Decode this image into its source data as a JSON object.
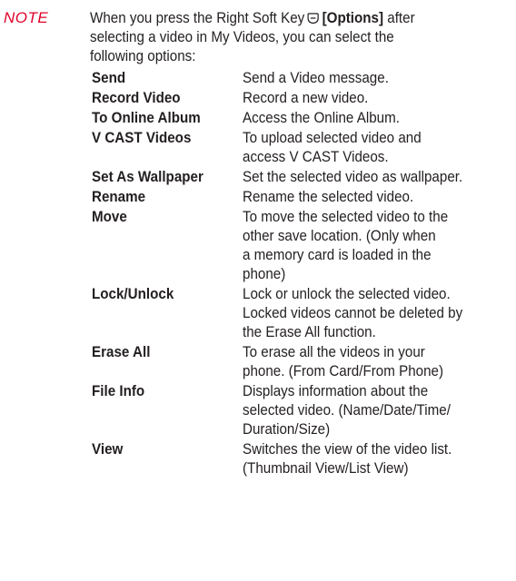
{
  "note": {
    "label": "NOTE",
    "text_before_key": "When you press the Right Soft Key",
    "key_icon": "right-soft-key-icon",
    "key_label": "[Options]",
    "text_line1_end": "after",
    "text_line2": "selecting a video in My Videos, you can select the",
    "text_line3": "following options:"
  },
  "options": [
    {
      "term": "Send",
      "desc": "Send a Video message."
    },
    {
      "term": "Record Video",
      "desc": "Record a new video."
    },
    {
      "term": "To Online Album",
      "desc": "Access the Online Album."
    },
    {
      "term": "V CAST Videos",
      "desc": "To upload selected video and\naccess V CAST Videos."
    },
    {
      "term": "Set As Wallpaper",
      "desc": "Set the selected video as wallpaper."
    },
    {
      "term": "Rename",
      "desc": "Rename the selected video."
    },
    {
      "term": "Move",
      "desc": "To move the selected video to the\nother save location. (Only when\na memory card is loaded in the\nphone)"
    },
    {
      "term": "Lock/Unlock",
      "desc": "Lock or unlock the selected video.\nLocked videos cannot be deleted by\nthe Erase All function."
    },
    {
      "term": "Erase All",
      "desc": "To erase all the videos in your\nphone. (From Card/From Phone)"
    },
    {
      "term": "File Info",
      "desc": "Displays information about the\nselected video. (Name/Date/Time/\nDuration/Size)"
    },
    {
      "term": "View",
      "desc": "Switches the view of the video list.\n(Thumbnail View/List View)"
    }
  ],
  "colors": {
    "note_label": "#e0002a",
    "text": "#231f20"
  }
}
